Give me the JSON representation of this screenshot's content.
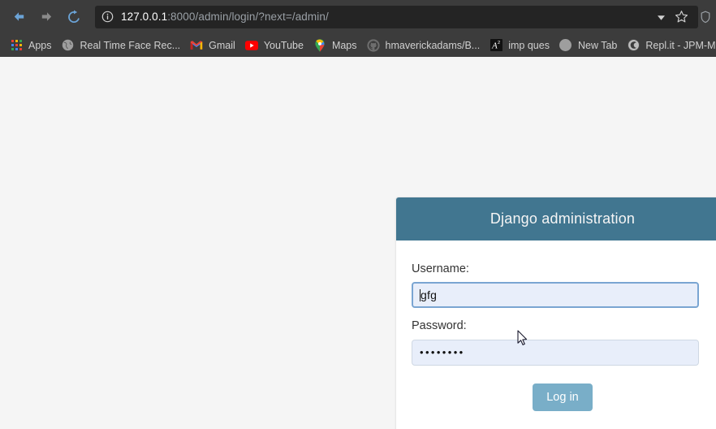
{
  "browser": {
    "nav": {
      "back_icon": "arrow-left-icon",
      "forward_icon": "arrow-right-icon",
      "reload_icon": "reload-icon"
    },
    "omnibox": {
      "info_icon": "info-circle-icon",
      "url_host": "127.0.0.1",
      "url_rest": ":8000/admin/login/?next=/admin/",
      "url_full": "127.0.0.1:8000/admin/login/?next=/admin/",
      "dropdown_icon": "chevron-down-icon",
      "star_icon": "star-bookmark-icon"
    },
    "bookmarks": [
      {
        "label": "Apps",
        "icon": "apps-grid-icon"
      },
      {
        "label": "Real Time Face Rec...",
        "icon": "globe-icon"
      },
      {
        "label": "Gmail",
        "icon": "gmail-icon"
      },
      {
        "label": "YouTube",
        "icon": "youtube-icon"
      },
      {
        "label": "Maps",
        "icon": "google-maps-pin-icon"
      },
      {
        "label": "hmaverickadams/B...",
        "icon": "github-icon"
      },
      {
        "label": "imp ques",
        "icon": "academia-a2-icon"
      },
      {
        "label": "New Tab",
        "icon": "blank-circle-icon"
      },
      {
        "label": "Repl.it - JPM-MOD",
        "icon": "replit-icon"
      }
    ]
  },
  "login": {
    "header_title": "Django administration",
    "username": {
      "label": "Username:",
      "value": "gfg",
      "focused": true
    },
    "password": {
      "label": "Password:",
      "value": "••••••••",
      "focused": false
    },
    "submit_label": "Log in"
  },
  "colors": {
    "django_header": "#417690",
    "django_button": "#79aec8",
    "page_background": "#f5f5f5",
    "chrome_background": "#3c3c3c",
    "omnibox_background": "#242424"
  }
}
